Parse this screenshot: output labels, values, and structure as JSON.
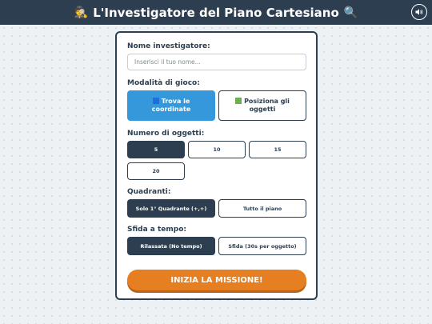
{
  "header": {
    "title_emoji_left": "🕵️",
    "title": "L'Investigatore del Piano Cartesiano",
    "title_emoji_right": "🔍",
    "sound_icon": "speaker-icon"
  },
  "form": {
    "name_label": "Nome investigatore:",
    "name_placeholder": "Inserisci il tuo nome...",
    "name_value": "",
    "mode_label": "Modalità di gioco:",
    "modes": [
      {
        "label": "Trova le coordinate",
        "swatch": "#1e6fd9",
        "selected": true
      },
      {
        "label": "Posiziona gli oggetti",
        "swatch": "#6ab04c",
        "selected": false
      }
    ],
    "count_label": "Numero di oggetti:",
    "counts": [
      {
        "label": "5",
        "selected": true
      },
      {
        "label": "10",
        "selected": false
      },
      {
        "label": "15",
        "selected": false
      },
      {
        "label": "20",
        "selected": false
      }
    ],
    "quadrant_label": "Quadranti:",
    "quadrants": [
      {
        "label": "Solo 1° Quadrante (+,+)",
        "selected": true
      },
      {
        "label": "Tutto il piano",
        "selected": false
      }
    ],
    "timer_label": "Sfida a tempo:",
    "timers": [
      {
        "label": "Rilassata (No tempo)",
        "selected": true
      },
      {
        "label": "Sfida (30s per oggetto)",
        "selected": false
      }
    ],
    "start_label": "INIZIA LA MISSIONE!"
  },
  "colors": {
    "primary": "#2c3e50",
    "accent": "#e67e22",
    "selected_mode": "#3498db"
  }
}
